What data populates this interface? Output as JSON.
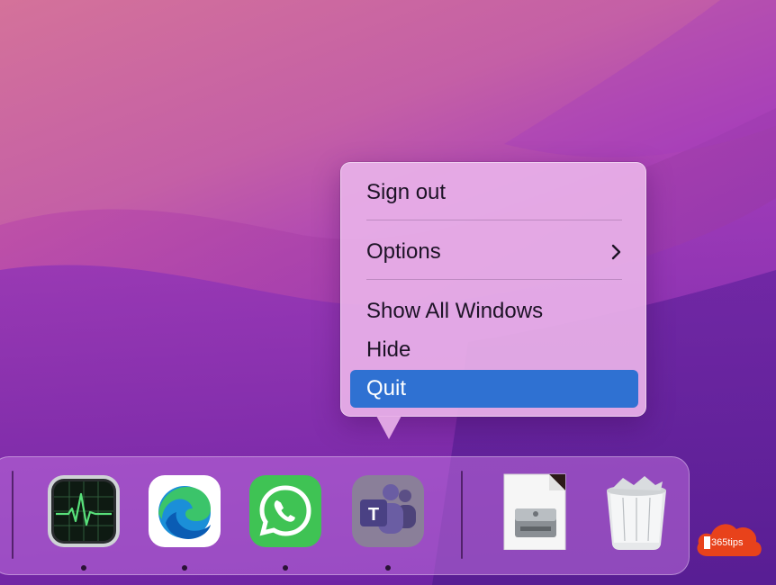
{
  "context_menu": {
    "items": [
      {
        "label": "Sign out"
      },
      {
        "label": "Options",
        "has_submenu": true
      },
      {
        "label": "Show All Windows"
      },
      {
        "label": "Hide"
      },
      {
        "label": "Quit",
        "highlighted": true
      }
    ],
    "highlight_color": "#2f71d2"
  },
  "dock": {
    "apps": [
      {
        "name": "Activity Monitor",
        "icon": "activity-monitor-icon",
        "running": true
      },
      {
        "name": "Microsoft Edge",
        "icon": "edge-icon",
        "running": true
      },
      {
        "name": "WhatsApp",
        "icon": "whatsapp-icon",
        "running": true
      },
      {
        "name": "Microsoft Teams",
        "icon": "teams-icon",
        "running": true
      },
      {
        "name": "Disk Image",
        "icon": "disk-image-icon",
        "running": false
      },
      {
        "name": "Trash",
        "icon": "trash-icon",
        "running": false
      }
    ]
  },
  "watermark": {
    "text": "365tips",
    "color": "#e8421b"
  }
}
